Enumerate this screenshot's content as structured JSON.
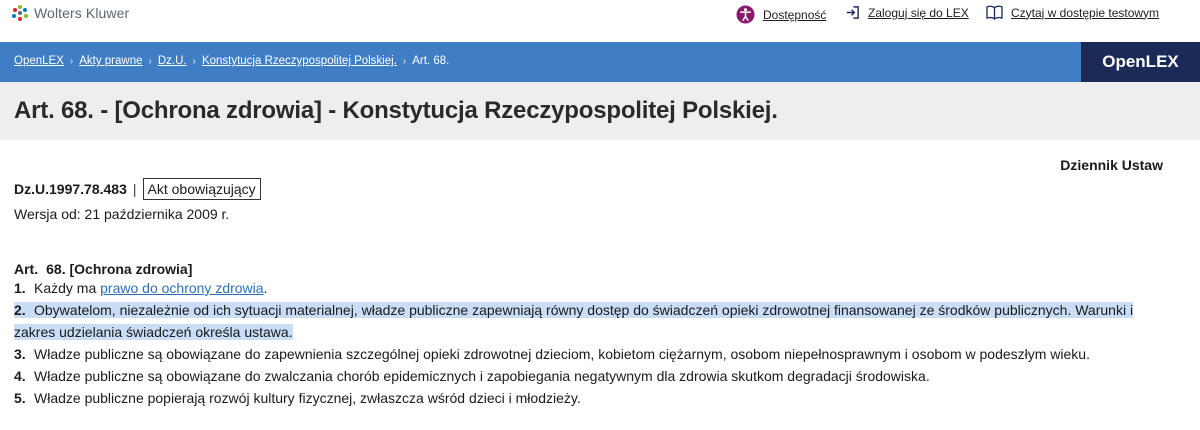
{
  "header": {
    "brand": "Wolters Kluwer",
    "links": {
      "accessibility": "Dostępność",
      "login": "Zaloguj się do LEX",
      "trial": "Czytaj w dostępie testowym"
    }
  },
  "breadcrumb": {
    "items": [
      "OpenLEX",
      "Akty prawne",
      "Dz.U.",
      "Konstytucja Rzeczypospolitej Polskiej."
    ],
    "current": "Art. 68."
  },
  "product": "OpenLEX",
  "page_title": "Art. 68. - [Ochrona zdrowia] - Konstytucja Rzeczypospolitej Polskiej.",
  "publication": "Dziennik Ustaw",
  "act": {
    "reference": "Dz.U.1997.78.483",
    "separator": "|",
    "status": "Akt obowiązujący",
    "version": "Wersja od: 21 października 2009 r."
  },
  "article": {
    "label": "Art.",
    "number": "68. [Ochrona zdrowia]",
    "paragraphs": [
      {
        "num": "1.",
        "prefix": "Każdy ma ",
        "link": "prawo do ochrony zdrowia",
        "suffix": "."
      },
      {
        "num": "2.",
        "text": "Obywatelom, niezależnie od ich sytuacji materialnej, władze publiczne zapewniają równy dostęp do świadczeń opieki zdrowotnej finansowanej ze środków publicznych. Warunki i zakres udzielania świadczeń określa ustawa."
      },
      {
        "num": "3.",
        "text": "Władze publiczne są obowiązane do zapewnienia szczególnej opieki zdrowotnej dzieciom, kobietom ciężarnym, osobom niepełnosprawnym i osobom w podeszłym wieku."
      },
      {
        "num": "4.",
        "text": "Władze publiczne są obowiązane do zwalczania chorób epidemicznych i zapobiegania negatywnym dla zdrowia skutkom degradacji środowiska."
      },
      {
        "num": "5.",
        "text": "Władze publiczne popierają rozwój kultury fizycznej, zwłaszcza wśród dzieci i młodzieży."
      }
    ]
  },
  "colors": {
    "band": "#3f7ec4",
    "brand_box": "#1b2a57",
    "highlight": "#c9ddf6",
    "link": "#2c6fb8",
    "accessibility_icon": "#8a1a6e"
  },
  "icons": [
    "wolters-kluwer-logo-icon",
    "accessibility-icon",
    "login-icon",
    "book-icon"
  ]
}
